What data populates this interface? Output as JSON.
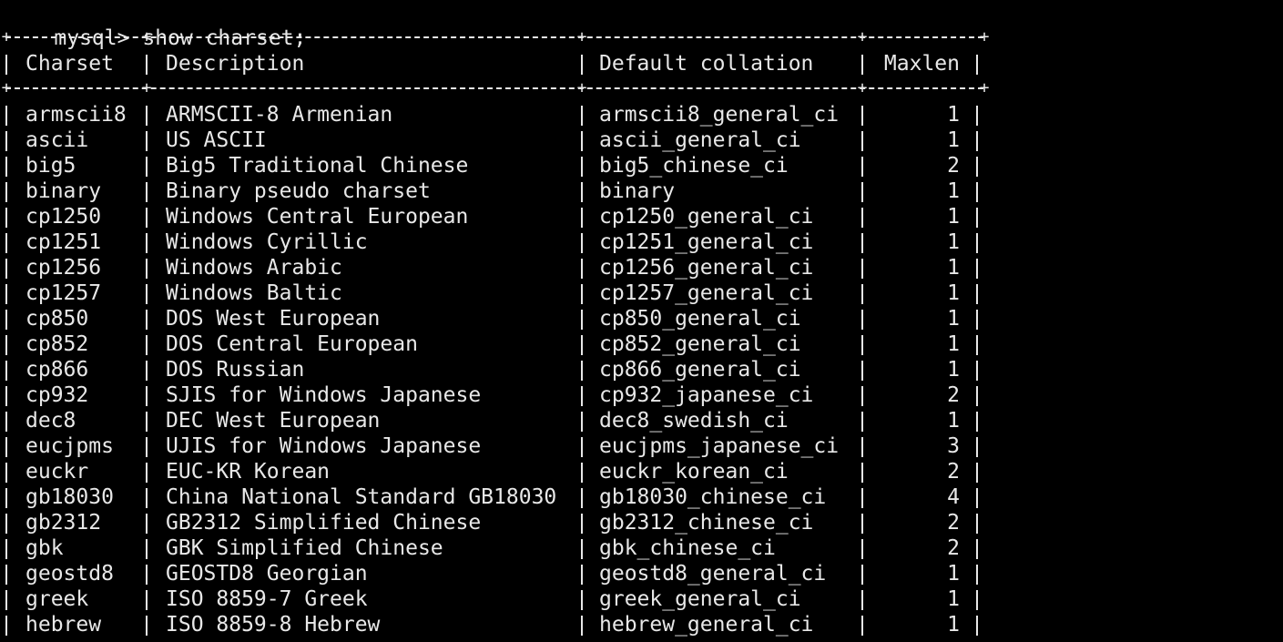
{
  "terminal": {
    "prompt": "mysql>",
    "command": "show charset;",
    "fg_color": "#e8e8e8",
    "bg_color": "#000000"
  },
  "table": {
    "headers": [
      "Charset",
      "Description",
      "Default collation",
      "Maxlen"
    ],
    "rows": [
      {
        "charset": "armscii8",
        "description": "ARMSCII-8 Armenian",
        "collation": "armscii8_general_ci",
        "maxlen": "1"
      },
      {
        "charset": "ascii",
        "description": "US ASCII",
        "collation": "ascii_general_ci",
        "maxlen": "1"
      },
      {
        "charset": "big5",
        "description": "Big5 Traditional Chinese",
        "collation": "big5_chinese_ci",
        "maxlen": "2"
      },
      {
        "charset": "binary",
        "description": "Binary pseudo charset",
        "collation": "binary",
        "maxlen": "1"
      },
      {
        "charset": "cp1250",
        "description": "Windows Central European",
        "collation": "cp1250_general_ci",
        "maxlen": "1"
      },
      {
        "charset": "cp1251",
        "description": "Windows Cyrillic",
        "collation": "cp1251_general_ci",
        "maxlen": "1"
      },
      {
        "charset": "cp1256",
        "description": "Windows Arabic",
        "collation": "cp1256_general_ci",
        "maxlen": "1"
      },
      {
        "charset": "cp1257",
        "description": "Windows Baltic",
        "collation": "cp1257_general_ci",
        "maxlen": "1"
      },
      {
        "charset": "cp850",
        "description": "DOS West European",
        "collation": "cp850_general_ci",
        "maxlen": "1"
      },
      {
        "charset": "cp852",
        "description": "DOS Central European",
        "collation": "cp852_general_ci",
        "maxlen": "1"
      },
      {
        "charset": "cp866",
        "description": "DOS Russian",
        "collation": "cp866_general_ci",
        "maxlen": "1"
      },
      {
        "charset": "cp932",
        "description": "SJIS for Windows Japanese",
        "collation": "cp932_japanese_ci",
        "maxlen": "2"
      },
      {
        "charset": "dec8",
        "description": "DEC West European",
        "collation": "dec8_swedish_ci",
        "maxlen": "1"
      },
      {
        "charset": "eucjpms",
        "description": "UJIS for Windows Japanese",
        "collation": "eucjpms_japanese_ci",
        "maxlen": "3"
      },
      {
        "charset": "euckr",
        "description": "EUC-KR Korean",
        "collation": "euckr_korean_ci",
        "maxlen": "2"
      },
      {
        "charset": "gb18030",
        "description": "China National Standard GB18030",
        "collation": "gb18030_chinese_ci",
        "maxlen": "4"
      },
      {
        "charset": "gb2312",
        "description": "GB2312 Simplified Chinese",
        "collation": "gb2312_chinese_ci",
        "maxlen": "2"
      },
      {
        "charset": "gbk",
        "description": "GBK Simplified Chinese",
        "collation": "gbk_chinese_ci",
        "maxlen": "2"
      },
      {
        "charset": "geostd8",
        "description": "GEOSTD8 Georgian",
        "collation": "geostd8_general_ci",
        "maxlen": "1"
      },
      {
        "charset": "greek",
        "description": "ISO 8859-7 Greek",
        "collation": "greek_general_ci",
        "maxlen": "1"
      },
      {
        "charset": "hebrew",
        "description": "ISO 8859-8 Hebrew",
        "collation": "hebrew_general_ci",
        "maxlen": "1"
      }
    ]
  }
}
